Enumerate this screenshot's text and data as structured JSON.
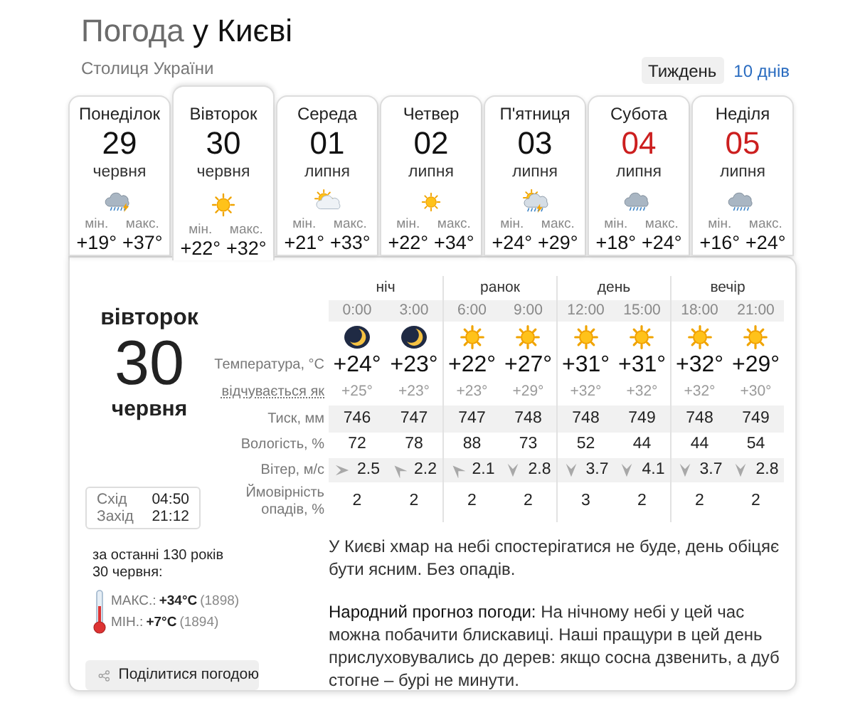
{
  "header": {
    "title_prefix": "Погода",
    "title_city": "у Києві",
    "subtitle": "Столиця України",
    "views": [
      {
        "label": "Тиждень",
        "selected": true
      },
      {
        "label": "10 днів",
        "selected": false
      }
    ]
  },
  "days": [
    {
      "weekday": "Понеділок",
      "date": "29",
      "month": "червня",
      "kind": "storm",
      "min_label": "мін.",
      "min": "+19°",
      "max_label": "макс.",
      "max": "+37°",
      "selected": false,
      "weekend": false
    },
    {
      "weekday": "Вівторок",
      "date": "30",
      "month": "червня",
      "kind": "sun",
      "min_label": "мін.",
      "min": "+22°",
      "max_label": "макс.",
      "max": "+32°",
      "selected": true,
      "weekend": false
    },
    {
      "weekday": "Середа",
      "date": "01",
      "month": "липня",
      "kind": "sun-cloud",
      "min_label": "мін.",
      "min": "+21°",
      "max_label": "макс.",
      "max": "+33°",
      "selected": false,
      "weekend": false
    },
    {
      "weekday": "Четвер",
      "date": "02",
      "month": "липня",
      "kind": "sun",
      "min_label": "мін.",
      "min": "+22°",
      "max_label": "макс.",
      "max": "+34°",
      "selected": false,
      "weekend": false
    },
    {
      "weekday": "П'ятниця",
      "date": "03",
      "month": "липня",
      "kind": "sun-storm",
      "min_label": "мін.",
      "min": "+24°",
      "max_label": "макс.",
      "max": "+29°",
      "selected": false,
      "weekend": false
    },
    {
      "weekday": "Субота",
      "date": "04",
      "month": "липня",
      "kind": "rain",
      "min_label": "мін.",
      "min": "+18°",
      "max_label": "макс.",
      "max": "+24°",
      "selected": false,
      "weekend": true
    },
    {
      "weekday": "Неділя",
      "date": "05",
      "month": "липня",
      "kind": "rain",
      "min_label": "мін.",
      "min": "+16°",
      "max_label": "макс.",
      "max": "+24°",
      "selected": false,
      "weekend": true
    }
  ],
  "detail": {
    "weekday": "вівторок",
    "date": "30",
    "month": "червня",
    "sun_times": [
      {
        "label": "Схід",
        "time": "04:50"
      },
      {
        "label": "Захід",
        "time": "21:12"
      }
    ],
    "history": {
      "heading": "за останні 130 років",
      "date": "30 червня:",
      "records": [
        {
          "label": "МАКС.:",
          "value": "+34°C",
          "year": "(1898)"
        },
        {
          "label": "МІН.:",
          "value": "+7°C",
          "year": "(1894)"
        }
      ]
    },
    "share": "Поділитися погодою",
    "row_labels": {
      "temp": "Температура, °C",
      "feels": "відчувається як",
      "pressure": "Тиск, мм",
      "humidity": "Вологість, %",
      "wind": "Вітер, м/с",
      "precip": "Ймовірність опадів, %"
    },
    "periods": [
      {
        "label": "ніч",
        "hours": [
          {
            "time": "0:00",
            "kind": "moon",
            "temp": "+24°",
            "feels": "+25°",
            "pressure": "746",
            "humidity": "72",
            "wind": {
              "kind": "right",
              "speed": "2.5"
            },
            "precip": "2"
          },
          {
            "time": "3:00",
            "kind": "moon",
            "temp": "+23°",
            "feels": "+23°",
            "pressure": "747",
            "humidity": "78",
            "wind": {
              "kind": "up-left",
              "speed": "2.2"
            },
            "precip": "2"
          }
        ]
      },
      {
        "label": "ранок",
        "hours": [
          {
            "time": "6:00",
            "kind": "sun",
            "temp": "+22°",
            "feels": "+23°",
            "pressure": "747",
            "humidity": "88",
            "wind": {
              "kind": "up-left",
              "speed": "2.1"
            },
            "precip": "2"
          },
          {
            "time": "9:00",
            "kind": "sun",
            "temp": "+27°",
            "feels": "+29°",
            "pressure": "748",
            "humidity": "73",
            "wind": {
              "kind": "down",
              "speed": "2.8"
            },
            "precip": "2"
          }
        ]
      },
      {
        "label": "день",
        "hours": [
          {
            "time": "12:00",
            "kind": "sun",
            "temp": "+31°",
            "feels": "+32°",
            "pressure": "748",
            "humidity": "52",
            "wind": {
              "kind": "down",
              "speed": "3.7"
            },
            "precip": "3"
          },
          {
            "time": "15:00",
            "kind": "sun",
            "temp": "+31°",
            "feels": "+32°",
            "pressure": "749",
            "humidity": "44",
            "wind": {
              "kind": "down",
              "speed": "4.1"
            },
            "precip": "2"
          }
        ]
      },
      {
        "label": "вечір",
        "hours": [
          {
            "time": "18:00",
            "kind": "sun",
            "temp": "+32°",
            "feels": "+32°",
            "pressure": "748",
            "humidity": "44",
            "wind": {
              "kind": "down",
              "speed": "3.7"
            },
            "precip": "2"
          },
          {
            "time": "21:00",
            "kind": "sun",
            "temp": "+29°",
            "feels": "+30°",
            "pressure": "749",
            "humidity": "54",
            "wind": {
              "kind": "down",
              "speed": "2.8"
            },
            "precip": "2"
          }
        ]
      }
    ],
    "description": "У Києві хмар на небі спостерігатися не буде, день обіцяє бути ясним. Без опадів.",
    "folk": "**Народний прогноз погоди:** На нічному небі у цей час можна побачити блискавиці. Наші пращури в цей день прислуховувались до дерев: якщо сосна дзвенить, а дуб стогне – бурі не минути."
  }
}
